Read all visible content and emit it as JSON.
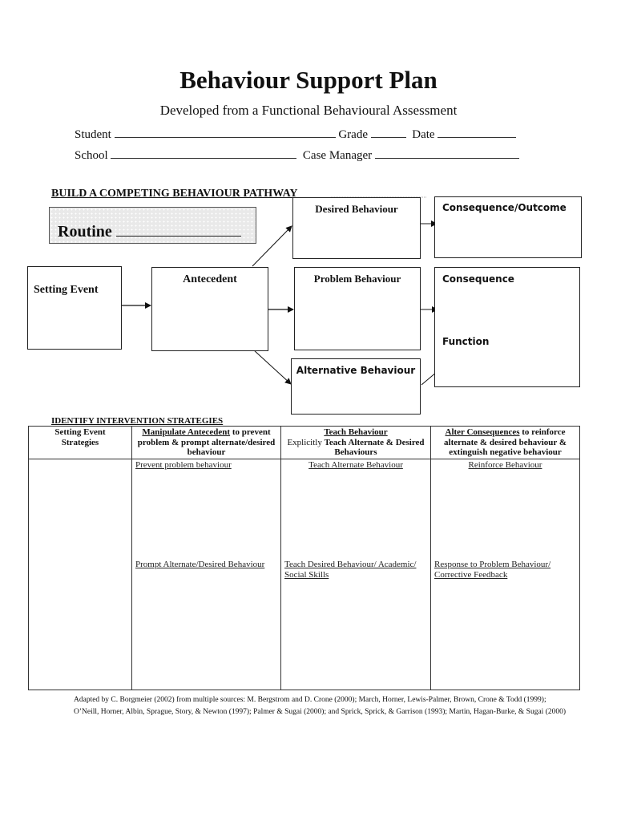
{
  "header": {
    "title": "Behaviour Support Plan",
    "subtitle": "Developed from a Functional Behavioural Assessment"
  },
  "fields": {
    "student_label": "Student",
    "student_value": "",
    "grade_label": "Grade",
    "grade_value": "",
    "date_label": "Date",
    "date_value": "",
    "school_label": "School",
    "school_value": "",
    "case_manager_label": "Case Manager",
    "case_manager_value": ""
  },
  "pathway": {
    "heading": "BUILD A COMPETING BEHAVIOUR PATHWAY",
    "routine_label": "Routine",
    "routine_value": "",
    "setting_event": "Setting Event",
    "antecedent": "Antecedent",
    "desired_behaviour": "Desired Behaviour",
    "problem_behaviour": "Problem Behaviour",
    "alternative_behaviour": "Alternative Behaviour",
    "consequence_outcome": "Consequence/Outcome",
    "consequence": "Consequence",
    "function": "Function"
  },
  "strategies": {
    "heading": "IDENTIFY INTERVENTION STRATEGIES",
    "columns": [
      {
        "title_line1": "Setting Event",
        "title_line2": "Strategies"
      },
      {
        "title_underlined": "Manipulate Antecedent",
        "title_rest": " to prevent problem & prompt alternate/desired behaviour"
      },
      {
        "title_underlined": "Teach Behaviour",
        "title_plain": "Explicitly ",
        "title_bold": "Teach Alternate  & Desired Behaviours"
      },
      {
        "title_underlined": "Alter Consequences",
        "title_rest": " to reinforce alternate & desired behaviour & extinguish negative behaviour"
      }
    ],
    "row1": [
      "",
      "Prevent problem behaviour",
      "Teach Alternate Behaviour",
      "Reinforce Behaviour"
    ],
    "row2": [
      "",
      "Prompt Alternate/Desired Behaviour",
      "Teach Desired Behaviour/ Academic/ Social Skills",
      "Response to Problem Behaviour/ Corrective Feedback"
    ]
  },
  "footnote": "Adapted by C. Borgmeier (2002) from multiple sources: M. Bergstrom and D. Crone (2000); March, Horner, Lewis-Palmer, Brown, Crone & Todd (1999); O’Neill, Horner, Albin, Sprague, Story, & Newton  (1997); Palmer & Sugai (2000); and Sprick, Sprick, & Garrison (1993); Martin, Hagan-Burke, & Sugai (2000)"
}
